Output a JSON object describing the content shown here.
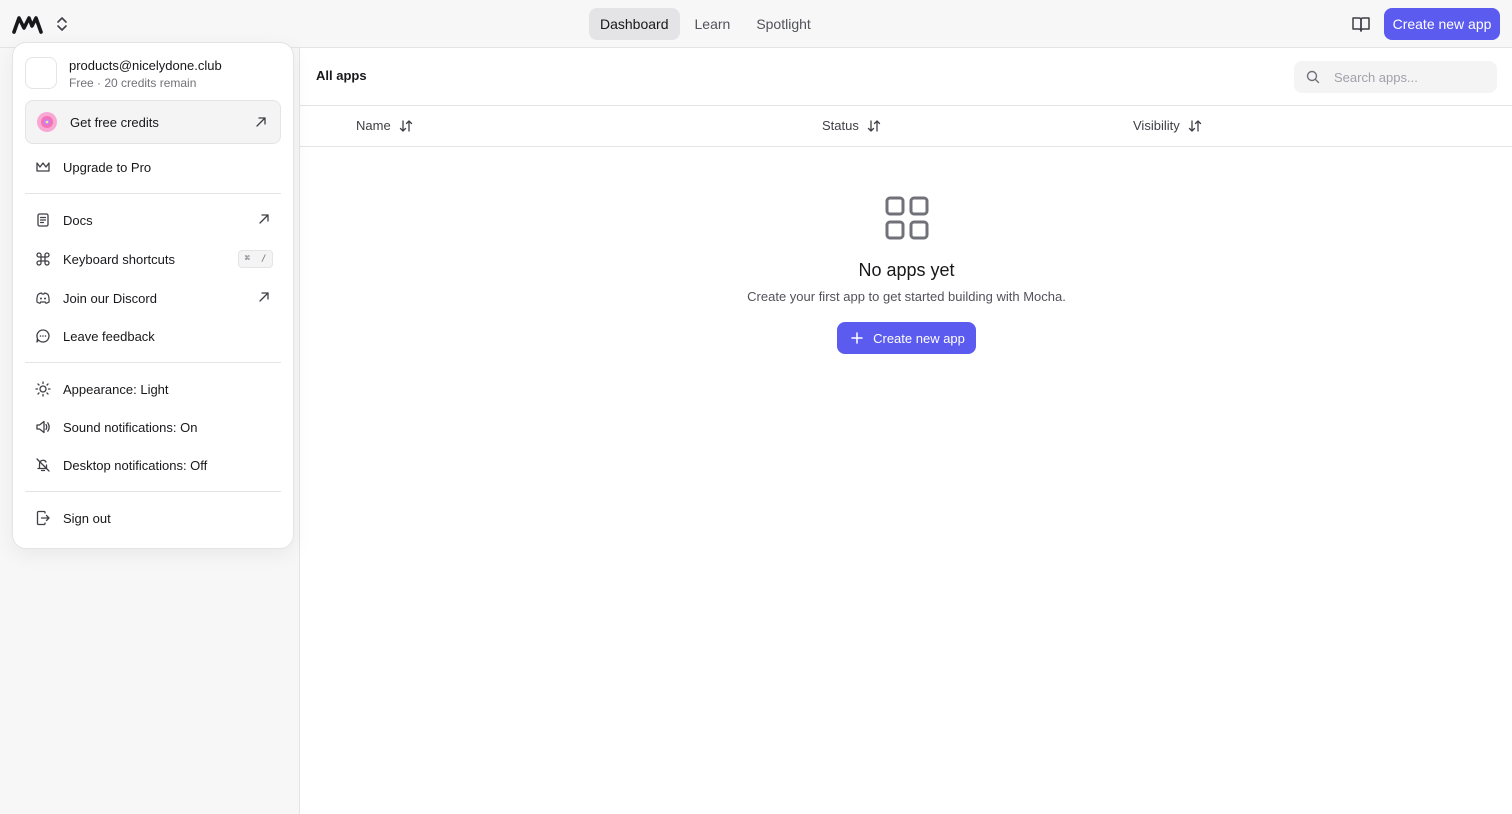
{
  "topbar": {
    "nav_tabs": [
      {
        "label": "Dashboard",
        "active": true
      },
      {
        "label": "Learn",
        "active": false
      },
      {
        "label": "Spotlight",
        "active": false
      }
    ],
    "create_button": "Create new app"
  },
  "main": {
    "title": "All apps",
    "search_placeholder": "Search apps...",
    "columns": [
      "Name",
      "Status",
      "Visibility"
    ],
    "empty": {
      "title": "No apps yet",
      "subtitle": "Create your first app to get started building with Mocha.",
      "button": "Create new app"
    }
  },
  "menu": {
    "email": "products@nicelydone.club",
    "plan": "Free",
    "credits_remaining": "20 credits remain",
    "get_credits": "Get free credits",
    "upgrade": "Upgrade to Pro",
    "docs": "Docs",
    "shortcuts": "Keyboard shortcuts",
    "shortcut_keys": [
      "⌘",
      "/"
    ],
    "discord": "Join our Discord",
    "feedback": "Leave feedback",
    "appearance": "Appearance: Light",
    "sound": "Sound notifications: On",
    "desktop": "Desktop notifications: Off",
    "sign_out": "Sign out"
  },
  "colors": {
    "accent": "#5b5bf0",
    "background": "#f7f7f8",
    "border": "#e4e4e7"
  }
}
